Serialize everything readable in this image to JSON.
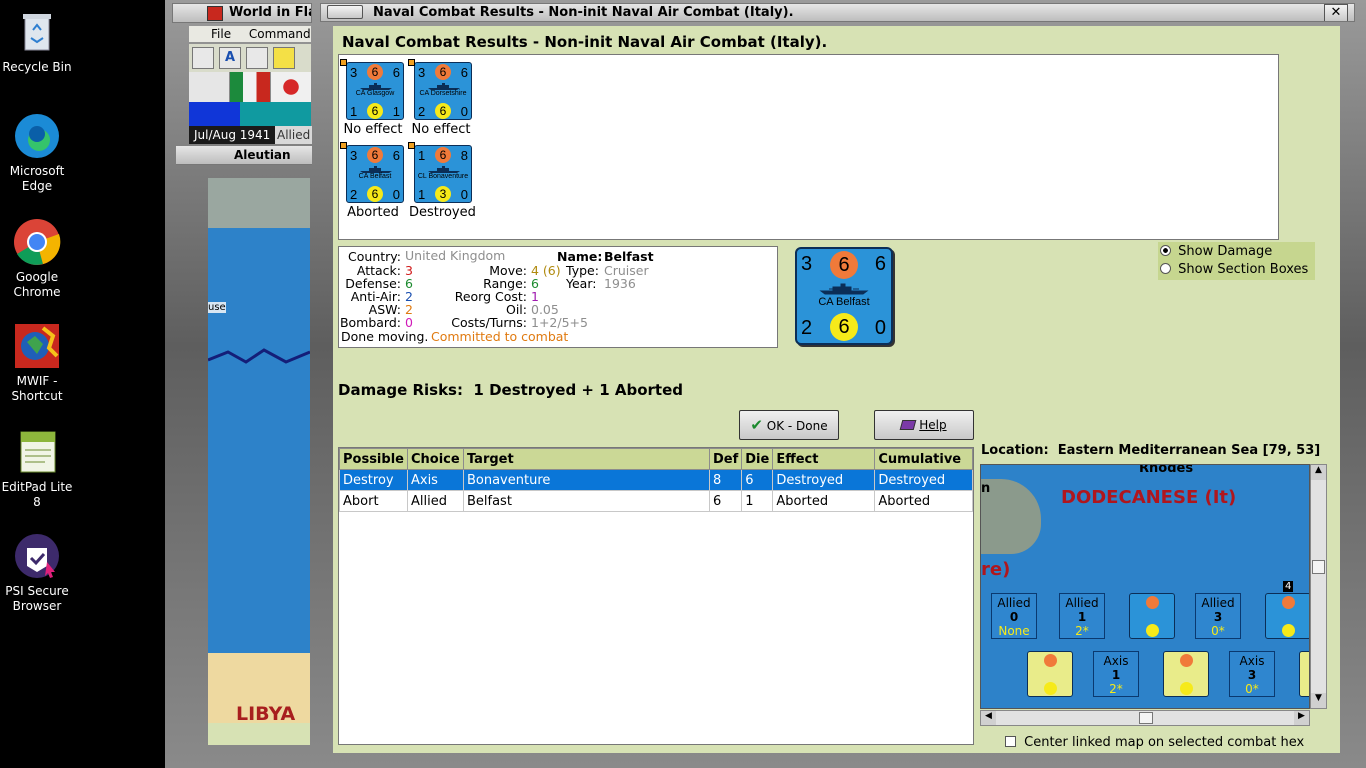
{
  "desktop": {
    "icons": [
      {
        "name": "recycle-bin",
        "label": "Recycle Bin"
      },
      {
        "name": "edge",
        "label": "Microsoft Edge"
      },
      {
        "name": "chrome",
        "label": "Google Chrome"
      },
      {
        "name": "mwif",
        "label": "MWIF - Shortcut"
      },
      {
        "name": "editpad",
        "label": "EditPad Lite 8"
      },
      {
        "name": "psi",
        "label": "PSI Secure Browser"
      }
    ]
  },
  "main_window": {
    "title": "World in Flames",
    "menu": [
      "File",
      "Command"
    ],
    "date": "Jul/Aug 1941",
    "side": "Allied",
    "map_panel": "Aleutian",
    "map_label": "LIBYA",
    "map_text": "use"
  },
  "dialog": {
    "title": "Naval Combat Results - Non-init Naval Air Combat (Italy).",
    "heading": "Naval Combat Results - Non-init Naval Air Combat (Italy).",
    "units": [
      {
        "attack": "3",
        "defense_top": "6",
        "right": "6",
        "name": "CA Glasgow",
        "bl": "1",
        "aa": "6",
        "br": "1",
        "result": "No effect"
      },
      {
        "attack": "3",
        "defense_top": "6",
        "right": "6",
        "name": "CA Dorsetshire",
        "bl": "2",
        "aa": "6",
        "br": "0",
        "result": "No effect"
      },
      {
        "attack": "3",
        "defense_top": "6",
        "right": "6",
        "name": "CA Belfast",
        "bl": "2",
        "aa": "6",
        "br": "0",
        "result": "Aborted"
      },
      {
        "attack": "1",
        "defense_top": "6",
        "right": "8",
        "name": "CL Bonaventure",
        "bl": "1",
        "aa": "3",
        "br": "0",
        "result": "Destroyed"
      }
    ],
    "info": {
      "country_label": "Country:",
      "country": "United Kingdom",
      "name_label": "Name:",
      "name": "Belfast",
      "attack_label": "Attack:",
      "attack": "3",
      "move_label": "Move:",
      "move": "4 (6)",
      "type_label": "Type:",
      "type": "Cruiser",
      "defense_label": "Defense:",
      "defense": "6",
      "range_label": "Range:",
      "range": "6",
      "year_label": "Year:",
      "year": "1936",
      "aa_label": "Anti-Air:",
      "aa": "2",
      "reorg_label": "Reorg Cost:",
      "reorg": "1",
      "asw_label": "ASW:",
      "asw": "2",
      "oil_label": "Oil:",
      "oil": "0.05",
      "bombard_label": "Bombard:",
      "bombard": "0",
      "costs_label": "Costs/Turns:",
      "costs": "1+2/5+5",
      "done_label": "Done moving.",
      "status": "Committed to combat"
    },
    "big_counter": {
      "tl": "3",
      "tc": "6",
      "tr": "6",
      "name": "CA Belfast",
      "bl": "2",
      "bc": "6",
      "br": "0"
    },
    "options": {
      "show_damage": "Show Damage",
      "show_sections": "Show Section Boxes"
    },
    "damage_risks": "Damage Risks:  1 Destroyed + 1 Aborted",
    "ok_label": "OK - Done",
    "help_label": "Help",
    "table": {
      "headers": [
        "Possible",
        "Choice",
        "Target",
        "Def",
        "Die",
        "Effect",
        "Cumulative"
      ],
      "rows": [
        [
          "Destroy",
          "Axis",
          "Bonaventure",
          "8",
          "6",
          "Destroyed",
          "Destroyed"
        ],
        [
          "Abort",
          "Allied",
          "Belfast",
          "6",
          "1",
          "Aborted",
          "Aborted"
        ]
      ]
    },
    "location": "Location:  Eastern Mediterranean Sea [79, 53]",
    "map": {
      "region": "DODECANESE (It)",
      "top_label": "Rhodes",
      "left_label": "n",
      "re_label": "re)",
      "boxes_allied": [
        {
          "side": "Allied",
          "num": "0",
          "sub": "None"
        },
        {
          "side": "Allied",
          "num": "1",
          "sub": "2*"
        },
        {
          "side": "Allied",
          "num": "3",
          "sub": "0*"
        }
      ],
      "boxes_axis": [
        {
          "side": "Axis",
          "num": "1",
          "sub": "2*"
        },
        {
          "side": "Axis",
          "num": "3",
          "sub": "0*"
        }
      ],
      "stack_num": "4"
    },
    "center_checkbox": "Center linked map on selected combat hex"
  },
  "colors": {
    "dialog_bg": "#d7e2b4",
    "selected_row": "#0a76d8",
    "counter_blue": "#2b93d8",
    "orange_circle": "#f07a3a",
    "yellow_circle": "#f6ea1a",
    "region_red": "#b0161d"
  }
}
